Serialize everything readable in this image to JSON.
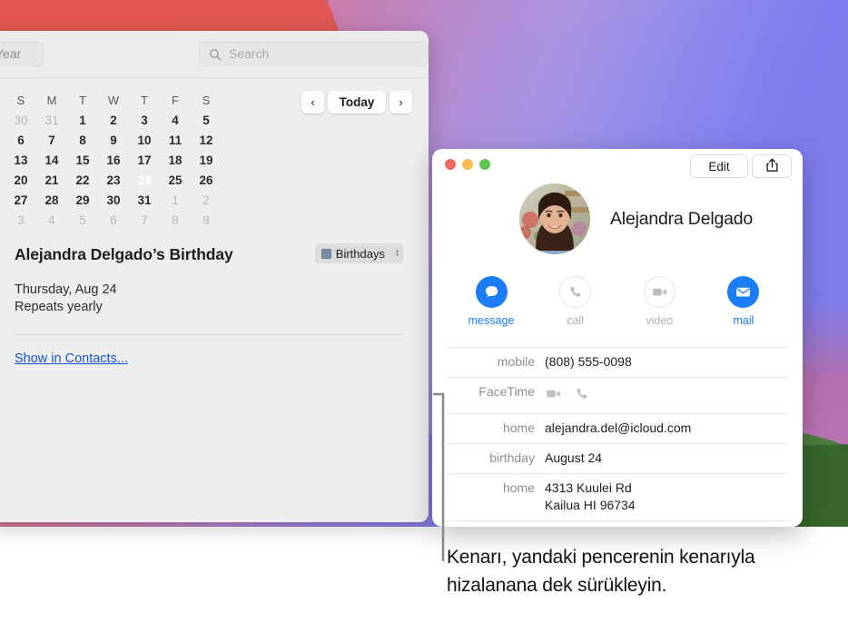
{
  "calendar_window": {
    "toolbar": {
      "year_button": "Year",
      "search_placeholder": "Search",
      "search_icon": "search-icon"
    },
    "nav": {
      "prev_label": "‹",
      "today_label": "Today",
      "next_label": "›"
    },
    "month_grid": {
      "weekday_headers": [
        "S",
        "M",
        "T",
        "W",
        "T",
        "F",
        "S"
      ],
      "today": 24,
      "weeks": [
        [
          {
            "d": "30",
            "dim": true
          },
          {
            "d": "31",
            "dim": true
          },
          {
            "d": "1"
          },
          {
            "d": "2"
          },
          {
            "d": "3"
          },
          {
            "d": "4"
          },
          {
            "d": "5"
          }
        ],
        [
          {
            "d": "6"
          },
          {
            "d": "7"
          },
          {
            "d": "8"
          },
          {
            "d": "9"
          },
          {
            "d": "10"
          },
          {
            "d": "11"
          },
          {
            "d": "12"
          }
        ],
        [
          {
            "d": "13"
          },
          {
            "d": "14"
          },
          {
            "d": "15"
          },
          {
            "d": "16"
          },
          {
            "d": "17"
          },
          {
            "d": "18"
          },
          {
            "d": "19"
          }
        ],
        [
          {
            "d": "20"
          },
          {
            "d": "21"
          },
          {
            "d": "22"
          },
          {
            "d": "23"
          },
          {
            "d": "24",
            "today": true
          },
          {
            "d": "25"
          },
          {
            "d": "26"
          }
        ],
        [
          {
            "d": "27"
          },
          {
            "d": "28"
          },
          {
            "d": "29"
          },
          {
            "d": "30"
          },
          {
            "d": "31"
          },
          {
            "d": "1",
            "dim": true
          },
          {
            "d": "2",
            "dim": true
          }
        ],
        [
          {
            "d": "3",
            "dim": true
          },
          {
            "d": "4",
            "dim": true
          },
          {
            "d": "5",
            "dim": true
          },
          {
            "d": "6",
            "dim": true
          },
          {
            "d": "7",
            "dim": true
          },
          {
            "d": "8",
            "dim": true
          },
          {
            "d": "9",
            "dim": true
          }
        ]
      ]
    },
    "event": {
      "title": "Alejandra Delgado’s Birthday",
      "calendar_name": "Birthdays",
      "calendar_color": "#7b8aa5",
      "date": "Thursday, Aug 24",
      "repeat": "Repeats yearly",
      "show_in_contacts": "Show in Contacts..."
    }
  },
  "contact_window": {
    "titlebar": {
      "edit_label": "Edit",
      "share_icon": "share-icon",
      "close_icon": "close-traffic-light",
      "minimize_icon": "minimize-traffic-light",
      "zoom_icon": "zoom-traffic-light"
    },
    "name": "Alejandra Delgado",
    "avatar_icon": "contact-photo",
    "actions": [
      {
        "label": "message",
        "icon": "message-bubble-icon",
        "enabled": true
      },
      {
        "label": "call",
        "icon": "phone-icon",
        "enabled": false
      },
      {
        "label": "video",
        "icon": "video-camera-icon",
        "enabled": false
      },
      {
        "label": "mail",
        "icon": "envelope-icon",
        "enabled": true
      }
    ],
    "fields": [
      {
        "label": "mobile",
        "value": "(808) 555-0098",
        "type": "text"
      },
      {
        "label": "FaceTime",
        "value": "",
        "type": "icons",
        "icons": [
          "video-camera-icon",
          "phone-icon"
        ]
      },
      {
        "label": "home",
        "value": "alejandra.del@icloud.com",
        "type": "text"
      },
      {
        "label": "birthday",
        "value": "August 24",
        "type": "text"
      },
      {
        "label": "home",
        "value": "4313 Kuulei Rd",
        "value2": "Kailua HI 96734",
        "type": "text"
      }
    ]
  },
  "callout": {
    "caption": "Kenarı, yandaki pencerenin kenarıyla hizalanana dek sürükleyin."
  },
  "colors": {
    "accent_blue": "#1a7cf7",
    "link_blue": "#1455d6",
    "today_badge": "#3a3a3a",
    "window_chrome": "#ececec"
  }
}
